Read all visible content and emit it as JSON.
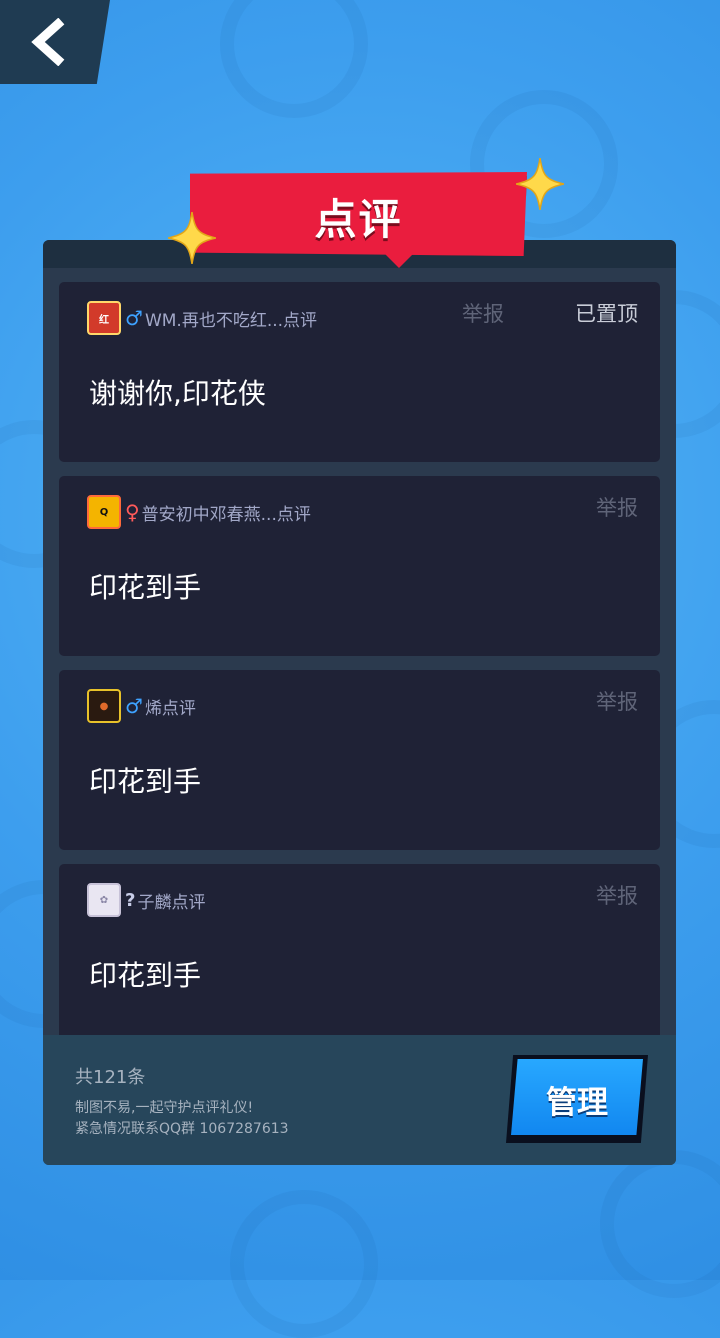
{
  "title": "点评",
  "comments": [
    {
      "user": "WM.再也不吃红...点评",
      "gender": "♂",
      "content": "谢谢你,印花侠",
      "report": "举报",
      "pinned": "已置顶"
    },
    {
      "user": "普安初中邓春燕...点评",
      "gender": "♀",
      "content": "印花到手",
      "report": "举报"
    },
    {
      "user": "烯点评",
      "gender": "♂",
      "content": "印花到手",
      "report": "举报"
    },
    {
      "user": "子麟点评",
      "gender": "?",
      "content": "印花到手",
      "report": "举报"
    }
  ],
  "footer": {
    "count": "共121条",
    "note1": "制图不易,一起守护点评礼仪!",
    "note2": "紧急情况联系QQ群 1067287613",
    "manage": "管理"
  },
  "colors": {
    "accent_red": "#ea1d3e",
    "button_blue": "#1a8ff5",
    "card_bg": "#1f2236"
  }
}
